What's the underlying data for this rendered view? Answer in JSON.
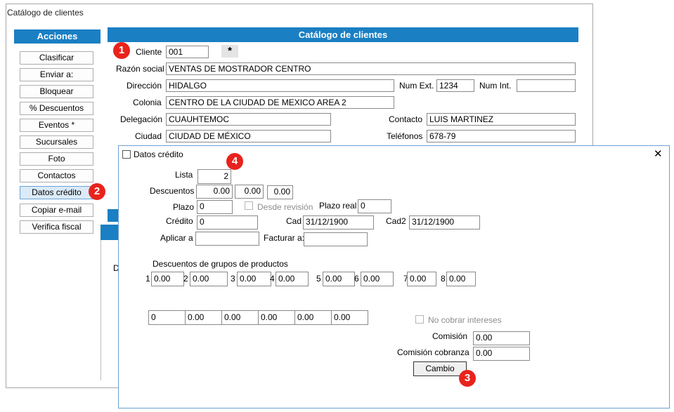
{
  "main_window": {
    "title": "Catálogo de clientes"
  },
  "actions": {
    "header": "Acciones",
    "buttons": [
      "Clasificar",
      "Enviar a:",
      "Bloquear",
      "% Descuentos",
      "Eventos *",
      "Sucursales",
      "Foto",
      "Contactos",
      "Datos crédito",
      "Copiar e-mail",
      "Verifica fiscal"
    ]
  },
  "catalog": {
    "header": "Catálogo de clientes",
    "cliente_label": "Cliente",
    "cliente_value": "001",
    "star_label": "*",
    "razon_label": "Razón social",
    "razon_value": "VENTAS DE MOSTRADOR CENTRO",
    "direccion_label": "Dirección",
    "direccion_value": "HIDALGO",
    "numext_label": "Num Ext.",
    "numext_value": "1234",
    "numint_label": "Num Int.",
    "numint_value": "",
    "colonia_label": "Colonia",
    "colonia_value": "CENTRO DE LA CIUDAD DE MEXICO AREA 2",
    "delegacion_label": "Delegación",
    "delegacion_value": "CUAUHTEMOC",
    "contacto_label": "Contacto",
    "contacto_value": "LUIS MARTINEZ",
    "ciudad_label": "Ciudad",
    "ciudad_value": "CIUDAD DE MÉXICO",
    "telefonos_label": "Teléfonos",
    "telefonos_value": "678-79",
    "hidden_label": "D"
  },
  "dialog": {
    "title": "Datos crédito",
    "close_glyph": "✕",
    "lista_label": "Lista",
    "lista_value": "2",
    "descuentos_label": "Descuentos",
    "descuentos_values": [
      "0.00",
      "0.00",
      "0.00"
    ],
    "plazo_label": "Plazo",
    "plazo_value": "0",
    "desde_revision_label": "Desde revisión",
    "plazo_real_label": "Plazo real",
    "plazo_real_value": "0",
    "credito_label": "Crédito",
    "credito_value": "0",
    "cad_label": "Cad",
    "cad_value": "31/12/1900",
    "cad2_label": "Cad2",
    "cad2_value": "31/12/1900",
    "aplicar_label": "Aplicar a",
    "aplicar_value": "",
    "facturar_label": "Facturar a:",
    "facturar_value": "",
    "grupos_label": "Descuentos de grupos de productos",
    "grupos": [
      {
        "n": "1",
        "v": "0.00"
      },
      {
        "n": "2",
        "v": "0.00"
      },
      {
        "n": "3",
        "v": "0.00"
      },
      {
        "n": "4",
        "v": "0.00"
      },
      {
        "n": "5",
        "v": "0.00"
      },
      {
        "n": "6",
        "v": "0.00"
      },
      {
        "n": "7",
        "v": "0.00"
      },
      {
        "n": "8",
        "v": "0.00"
      }
    ],
    "row_values": [
      "0",
      "0.00",
      "0.00",
      "0.00",
      "0.00",
      "0.00"
    ],
    "no_cobrar_label": "No cobrar intereses",
    "comision_label": "Comisión",
    "comision_value": "0.00",
    "comision_cobranza_label": "Comisión cobranza",
    "comision_cobranza_value": "0.00",
    "cambio_label": "Cambio"
  },
  "badges": [
    "1",
    "2",
    "3",
    "4"
  ],
  "colors": {
    "header_blue": "#1a7fc3",
    "badge_red": "#e8231c",
    "dialog_border": "#6d9fd6"
  }
}
